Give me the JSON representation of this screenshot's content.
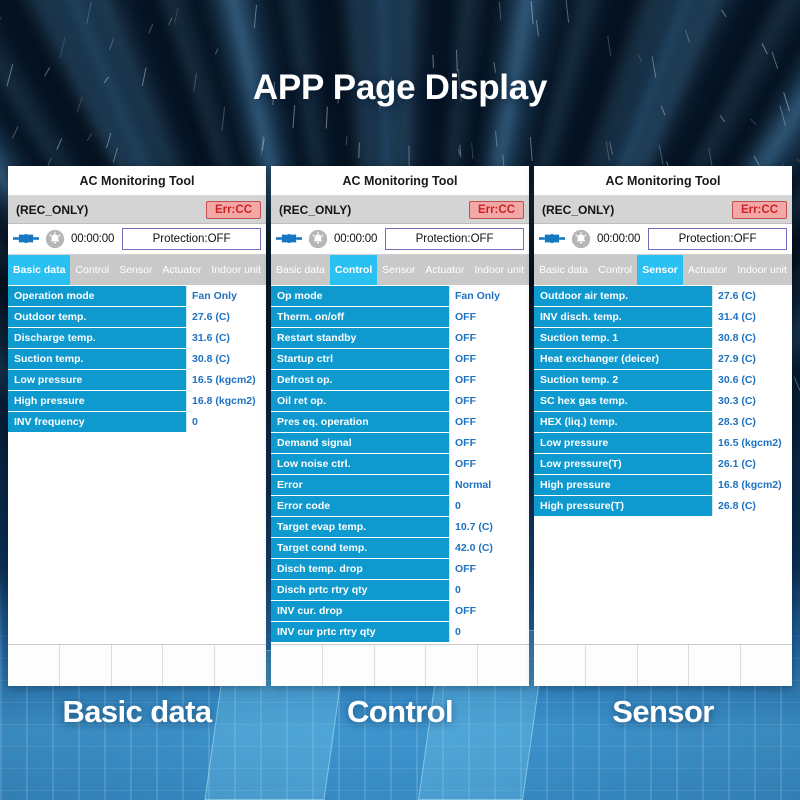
{
  "page": {
    "title": "APP Page Display",
    "accent_cyan": "#2bc0f2",
    "row_label_blue": "#0e9acf",
    "row_value_blue": "#1f72c0",
    "error_red": "#cf2222"
  },
  "common": {
    "app_title": "AC Monitoring Tool",
    "status_label": "(REC_ONLY)",
    "error_badge": "Err:CC",
    "timer": "00:00:00",
    "protection": "Protection:OFF",
    "plug_icon": "plug-icon",
    "bell_icon": "bell-icon",
    "tabs": [
      "Basic data",
      "Control",
      "Sensor",
      "Actuator",
      "Indoor unit"
    ],
    "toolbar_icons": [
      "chart-icon",
      "sliders-icon",
      "transfer-icon",
      "stop-circle-icon",
      "home-icon"
    ]
  },
  "panels": [
    {
      "caption": "Basic data",
      "active_tab": "Basic data",
      "rows": [
        {
          "key": "Operation mode",
          "value": "Fan Only"
        },
        {
          "key": "Outdoor temp.",
          "value": "27.6 (C)"
        },
        {
          "key": "Discharge temp.",
          "value": "31.6 (C)"
        },
        {
          "key": "Suction temp.",
          "value": "30.8 (C)"
        },
        {
          "key": "Low pressure",
          "value": "16.5 (kgcm2)"
        },
        {
          "key": "High pressure",
          "value": "16.8 (kgcm2)"
        },
        {
          "key": "INV frequency",
          "value": "0"
        }
      ]
    },
    {
      "caption": "Control",
      "active_tab": "Control",
      "rows": [
        {
          "key": "Op mode",
          "value": "Fan Only"
        },
        {
          "key": "Therm. on/off",
          "value": "OFF"
        },
        {
          "key": "Restart standby",
          "value": "OFF"
        },
        {
          "key": "Startup ctrl",
          "value": "OFF"
        },
        {
          "key": "Defrost op.",
          "value": "OFF"
        },
        {
          "key": "Oil ret op.",
          "value": "OFF"
        },
        {
          "key": "Pres eq. operation",
          "value": "OFF"
        },
        {
          "key": "Demand signal",
          "value": "OFF"
        },
        {
          "key": "Low noise ctrl.",
          "value": "OFF"
        },
        {
          "key": "Error",
          "value": "Normal"
        },
        {
          "key": "Error code",
          "value": "0"
        },
        {
          "key": "Target evap temp.",
          "value": "10.7 (C)"
        },
        {
          "key": "Target cond temp.",
          "value": "42.0 (C)"
        },
        {
          "key": "Disch temp. drop",
          "value": "OFF"
        },
        {
          "key": "Disch prtc rtry qty",
          "value": "0"
        },
        {
          "key": "INV cur. drop",
          "value": "OFF"
        },
        {
          "key": "INV cur prtc rtry qty",
          "value": "0"
        }
      ]
    },
    {
      "caption": "Sensor",
      "active_tab": "Sensor",
      "rows": [
        {
          "key": "Outdoor air temp.",
          "value": "27.6 (C)"
        },
        {
          "key": "INV disch. temp.",
          "value": "31.4 (C)"
        },
        {
          "key": "Suction temp. 1",
          "value": "30.8 (C)"
        },
        {
          "key": "Heat exchanger (deicer)",
          "value": "27.9 (C)"
        },
        {
          "key": "Suction temp. 2",
          "value": "30.6 (C)"
        },
        {
          "key": "SC hex gas temp.",
          "value": "30.3 (C)"
        },
        {
          "key": "HEX (liq.) temp.",
          "value": "28.3 (C)"
        },
        {
          "key": "Low pressure",
          "value": "16.5 (kgcm2)"
        },
        {
          "key": "Low pressure(T)",
          "value": "26.1 (C)"
        },
        {
          "key": "High pressure",
          "value": "16.8 (kgcm2)"
        },
        {
          "key": "High pressure(T)",
          "value": "26.8 (C)"
        }
      ]
    }
  ]
}
